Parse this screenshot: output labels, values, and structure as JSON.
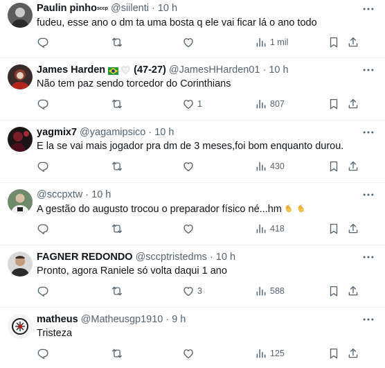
{
  "tweets": [
    {
      "name": "Paulin pinho",
      "name_badge": "sccp",
      "handle": "@siilenti",
      "dot": "·",
      "time": "10 h",
      "text": "fudeu, esse ano o dm ta uma bosta q ele vai ficar lá o ano todo",
      "replies": "",
      "retweets": "",
      "likes": "",
      "views": "1 mil"
    },
    {
      "name": "James Harden",
      "record": "(47-27)",
      "handle": "@JamesHHarden01",
      "dot": "·",
      "time": "10 h",
      "text": "Não tem paz sendo torcedor do Corinthians",
      "replies": "",
      "retweets": "",
      "likes": "1",
      "views": "807"
    },
    {
      "name": "yagmix7",
      "handle": "@yagamipsico",
      "dot": "·",
      "time": "10 h",
      "text": "E la se vai mais jogador pra dm de 3 meses,foi bom enquanto durou.",
      "replies": "",
      "retweets": "",
      "likes": "",
      "views": "430"
    },
    {
      "name": "",
      "handle": "@sccpxtw",
      "dot": "·",
      "time": "10 h",
      "text": "A gestão do augusto trocou o preparador físico né...hm",
      "replies": "",
      "retweets": "",
      "likes": "",
      "views": "418"
    },
    {
      "name": "FAGNER REDONDO",
      "handle": "@sccptristedms",
      "dot": "·",
      "time": "10 h",
      "text": "Pronto, agora Raniele só volta daqui 1 ano",
      "replies": "",
      "retweets": "",
      "likes": "3",
      "views": "588"
    },
    {
      "name": "matheus",
      "handle": "@Matheusgp1910",
      "dot": "·",
      "time": "9 h",
      "text": "Tristeza",
      "replies": "",
      "retweets": "",
      "likes": "",
      "views": "125"
    }
  ],
  "icons": {
    "reply": "reply-icon",
    "retweet": "retweet-icon",
    "like": "heart-icon",
    "views": "views-icon",
    "bookmark": "bookmark-icon",
    "share": "share-icon",
    "more": "more-icon"
  },
  "colors": {
    "text": "#0f1419",
    "secondary": "#536471",
    "divider": "#eff3f4"
  }
}
